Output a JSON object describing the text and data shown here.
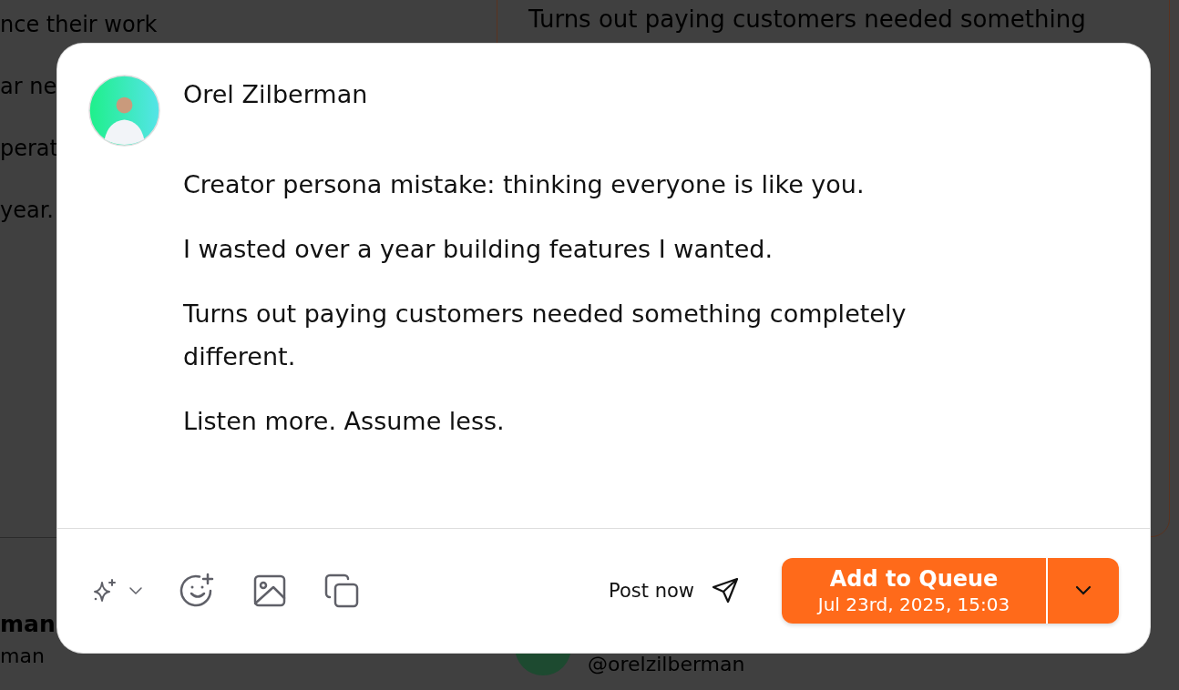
{
  "background": {
    "left_lines": [
      "nce their work",
      "ar ne",
      "perat",
      "year."
    ],
    "right_card_text": "Turns out paying customers needed something",
    "bottom_left": {
      "name": "man",
      "handle": "man"
    },
    "bottom_right": {
      "handle": "@orelzilberman"
    }
  },
  "composer": {
    "author": "Orel Zilberman",
    "paragraphs": [
      "Creator persona mistake: thinking everyone is like you.",
      "I wasted over a year building features I wanted.",
      "Turns out paying customers needed something completely different.",
      "Listen more. Assume less."
    ],
    "post_now": "Post now",
    "queue_button": {
      "label": "Add to Queue",
      "date": "Jul 23rd, 2025, 15:03"
    }
  }
}
